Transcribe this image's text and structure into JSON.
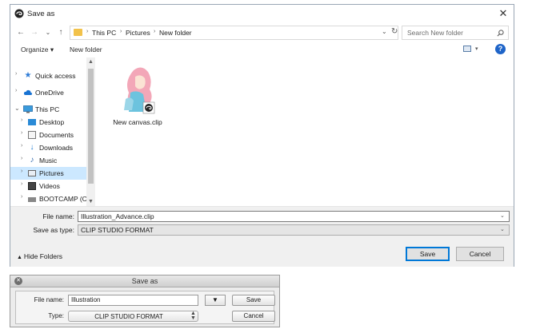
{
  "win": {
    "title": "Save as",
    "close_glyph": "✕",
    "nav": {
      "back": "←",
      "forward": "→",
      "recent": "⌄",
      "up": "↑",
      "breadcrumb": [
        "This PC",
        "Pictures",
        "New folder"
      ],
      "search_placeholder": "Search New folder"
    },
    "toolbar": {
      "organize": "Organize ▾",
      "new_folder": "New folder",
      "help": "?"
    },
    "nav_pane": {
      "items": [
        {
          "label": "Quick access",
          "icon": "star-icon"
        },
        {
          "label": "OneDrive",
          "icon": "cloud-icon"
        },
        {
          "label": "This PC",
          "icon": "computer-icon"
        },
        {
          "label": "Desktop",
          "icon": "desktop-icon"
        },
        {
          "label": "Documents",
          "icon": "documents-icon"
        },
        {
          "label": "Downloads",
          "icon": "downloads-icon"
        },
        {
          "label": "Music",
          "icon": "music-icon"
        },
        {
          "label": "Pictures",
          "icon": "pictures-icon"
        },
        {
          "label": "Videos",
          "icon": "videos-icon"
        },
        {
          "label": "BOOTCAMP (C:)",
          "icon": "drive-icon"
        }
      ]
    },
    "files": [
      {
        "label": "New canvas.clip"
      }
    ],
    "form": {
      "filename_label": "File name:",
      "filename_value": "Illustration_Advance.clip",
      "type_label": "Save as type:",
      "type_value": "CLIP STUDIO FORMAT",
      "hide_folders": "Hide Folders",
      "save": "Save",
      "cancel": "Cancel"
    }
  },
  "mac": {
    "title": "Save as",
    "filename_label": "File name:",
    "filename_value": "Illustration",
    "type_label": "Type:",
    "type_value": "CLIP STUDIO FORMAT",
    "dropdown_glyph": "▼",
    "save": "Save",
    "cancel": "Cancel"
  },
  "colors": {
    "accent": "#0078d7",
    "selection": "#cce8ff",
    "help": "#1e64c8"
  }
}
